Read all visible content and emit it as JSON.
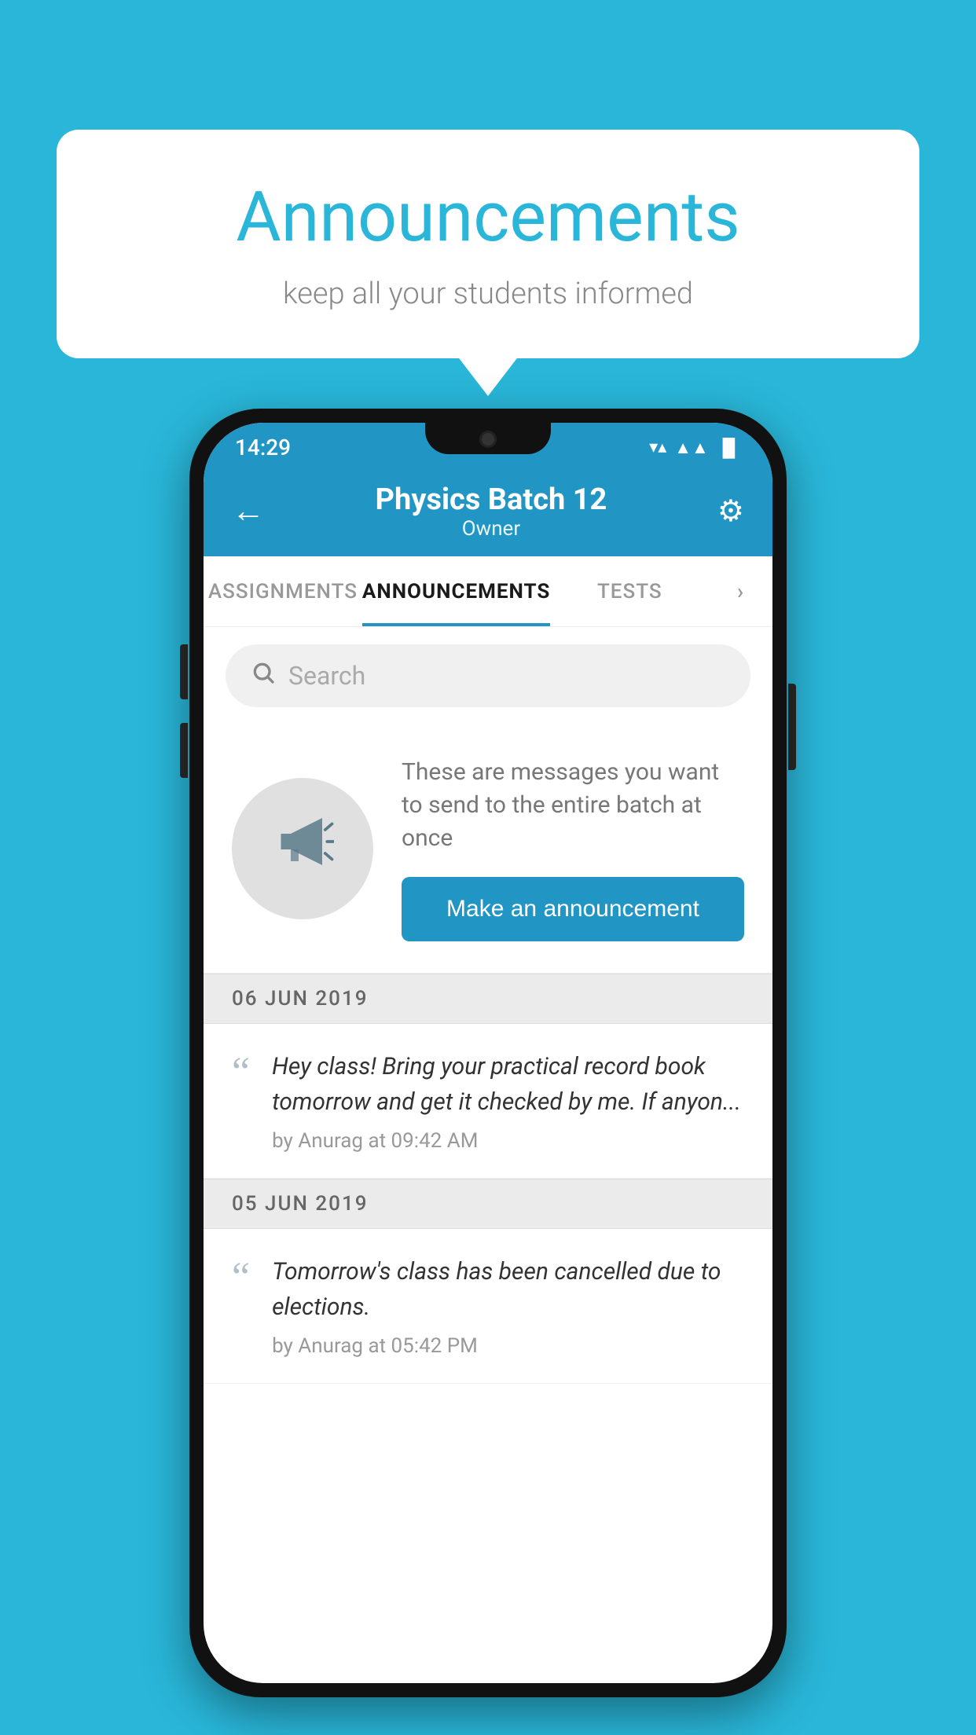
{
  "background_color": "#29b6d8",
  "speech_bubble": {
    "title": "Announcements",
    "subtitle": "keep all your students informed"
  },
  "phone": {
    "status_bar": {
      "time": "14:29",
      "icons": [
        "wifi",
        "signal",
        "battery"
      ]
    },
    "app_bar": {
      "back_label": "←",
      "title": "Physics Batch 12",
      "subtitle": "Owner",
      "settings_label": "⚙"
    },
    "tabs": [
      {
        "label": "ASSIGNMENTS",
        "active": false
      },
      {
        "label": "ANNOUNCEMENTS",
        "active": true
      },
      {
        "label": "TESTS",
        "active": false
      },
      {
        "label": "›",
        "active": false
      }
    ],
    "search": {
      "placeholder": "Search"
    },
    "promo": {
      "description": "These are messages you want to send to the entire batch at once",
      "button_label": "Make an announcement"
    },
    "announcements": [
      {
        "date": "06  JUN  2019",
        "text": "Hey class! Bring your practical record book tomorrow and get it checked by me. If anyon...",
        "meta": "by Anurag at 09:42 AM"
      },
      {
        "date": "05  JUN  2019",
        "text": "Tomorrow's class has been cancelled due to elections.",
        "meta": "by Anurag at 05:42 PM"
      }
    ]
  }
}
